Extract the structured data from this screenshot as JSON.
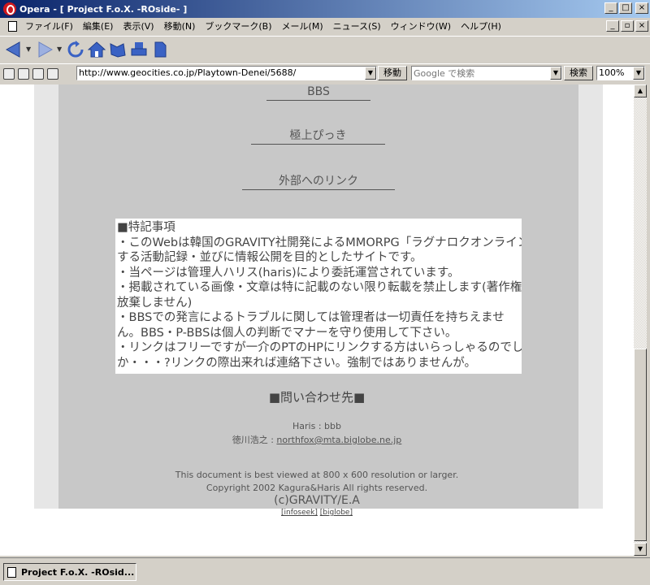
{
  "window": {
    "title": "Opera - [ Project F.o.X. -ROside- ]",
    "controls": {
      "minimize": "_",
      "maximize": "□",
      "close": "×"
    },
    "mdi_controls": {
      "minimize": "_",
      "restore": "▫",
      "close": "×"
    }
  },
  "menu": [
    "ファイル(F)",
    "編集(E)",
    "表示(V)",
    "移動(N)",
    "ブックマーク(B)",
    "メール(M)",
    "ニュース(S)",
    "ウィンドウ(W)",
    "ヘルプ(H)"
  ],
  "toolbar": {
    "icons": [
      "back-icon",
      "forward-icon",
      "reload-icon",
      "home-icon",
      "hotlist-icon",
      "print-icon",
      "document-icon"
    ]
  },
  "address": {
    "url": "http://www.geocities.co.jp/Playtown-Denei/5688/",
    "go_label": "移動",
    "search_placeholder": "Google で検索",
    "search_label": "検索",
    "zoom": "100%"
  },
  "page": {
    "nav_links": [
      "BBS",
      "極上ぴっき",
      "外部へのリンク"
    ],
    "notice_lines": [
      "■特記事項",
      "・このWebは韓国のGRAVITY社開発によるMMORPG「ラグナロクオンライン」に関",
      "する活動記録・並びに情報公開を目的としたサイトです。",
      "・当ページは管理人ハリス(haris)により委託運営されています。",
      "・掲載されている画像・文章は特に記載のない限り転載を禁止します(著作権を",
      "放棄しません)",
      "・BBSでの発言によるトラブルに関しては管理者は一切責任を持ちえませ",
      "ん。BBS・P-BBSは個人の判断でマナーを守り使用して下さい。",
      "・リンクはフリーですが一介のPTのHPにリンクする方はいらっしゃるのでしょう",
      "か・・・?リンクの際出来れば連絡下さい。強制ではありませんが。"
    ],
    "contact_title": "■問い合わせ先■",
    "contact_haris": "Haris : bbb",
    "contact_tokugawa_label": "徳川浩之 : ",
    "contact_email": "northfox@mta.biglobe.ne.jp",
    "viewed_note": "This document is best viewed at 800 x 600 resolution or larger.",
    "copyright": "Copyright 2002 Kagura&Haris All rights reserved.",
    "gravity_credit": "(c)GRAVITY/E.A",
    "footer_link_1": "[infoseek]",
    "footer_link_2": "[biglobe]"
  },
  "tab": {
    "label": "Project F.o.X. -ROsid..."
  }
}
